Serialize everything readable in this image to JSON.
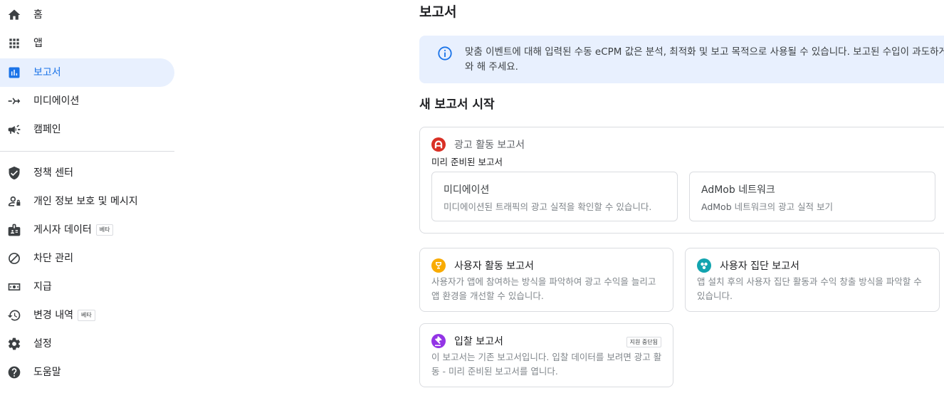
{
  "sidebar": {
    "items": [
      {
        "label": "홈",
        "icon": "home-icon"
      },
      {
        "label": "앱",
        "icon": "apps-grid-icon"
      },
      {
        "label": "보고서",
        "icon": "bar-chart-icon",
        "active": true
      },
      {
        "label": "미디에이션",
        "icon": "mediation-icon"
      },
      {
        "label": "캠페인",
        "icon": "megaphone-icon"
      },
      {
        "label": "정책 센터",
        "icon": "shield-check-icon"
      },
      {
        "label": "개인 정보 보호 및 메시지",
        "icon": "person-privacy-icon"
      },
      {
        "label": "게시자 데이터",
        "icon": "badge-icon",
        "badge": "베타"
      },
      {
        "label": "차단 관리",
        "icon": "block-icon"
      },
      {
        "label": "지급",
        "icon": "payments-icon"
      },
      {
        "label": "변경 내역",
        "icon": "history-icon",
        "badge": "베타"
      },
      {
        "label": "설정",
        "icon": "gear-icon"
      },
      {
        "label": "도움말",
        "icon": "help-icon"
      }
    ]
  },
  "main": {
    "title": "보고서",
    "info_banner": "맞춤 이벤트에 대해 입력된 수동 eCPM 값은 분석, 최적화 및 보고 목적으로 사용될 수 있습니다. 보고된 수입이 과도하게 와 해 주세요.",
    "section_title": "새 보고서 시작",
    "ad_activity": {
      "title": "광고 활동 보고서",
      "prebuilt_label": "미리 준비된 보고서",
      "mediation_title": "미디에이션",
      "mediation_desc": "미디에이션된 트래픽의 광고 실적을 확인할 수 있습니다.",
      "admob_title": "AdMob 네트워크",
      "admob_desc_strong": "AdMob",
      "admob_desc_rest": " 네트워크의 광고 실적 보기"
    },
    "user_activity": {
      "title": "사용자 활동 보고서",
      "desc": "사용자가 앱에 참여하는 방식을 파악하여 광고 수익을 늘리고 앱 환경을 개선할 수 있습니다."
    },
    "cohort": {
      "title": "사용자 집단 보고서",
      "desc": "앱 설치 후의 사용자 집단 활동과 수익 창출 방식을 파악할 수 있습니다."
    },
    "bidding": {
      "title": "입찰 보고서",
      "badge": "지원 중단됨",
      "desc": "이 보고서는 기존 보고서입니다. 입찰 데이터를 보려면 광고 활동 - 미리 준비된 보고서를 엽니다."
    }
  },
  "colors": {
    "accent": "#1a73e8",
    "active_bg": "#e8f0fe",
    "ad_activity_icon": "#d93025",
    "user_activity_icon": "#f9ab00",
    "cohort_icon": "#12a4af",
    "bidding_icon": "#9334e6"
  }
}
